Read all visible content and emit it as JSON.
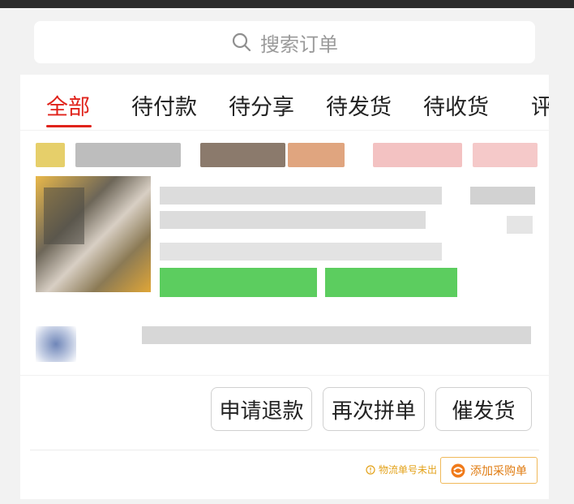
{
  "search": {
    "placeholder": "搜索订单"
  },
  "tabs": [
    {
      "label": "全部",
      "active": true
    },
    {
      "label": "待付款",
      "active": false
    },
    {
      "label": "待分享",
      "active": false
    },
    {
      "label": "待发货",
      "active": false
    },
    {
      "label": "待收货",
      "active": false
    },
    {
      "label": "评",
      "active": false
    }
  ],
  "order": {
    "actions": [
      "申请退款",
      "再次拼单",
      "催发货"
    ],
    "logistics_hint": "物流单号未出",
    "add_to_purchase_label": "添加采购单"
  },
  "colors": {
    "accent_red": "#e0231b",
    "hint_orange": "#e3a21a",
    "purchase_orange": "#e07c12"
  }
}
